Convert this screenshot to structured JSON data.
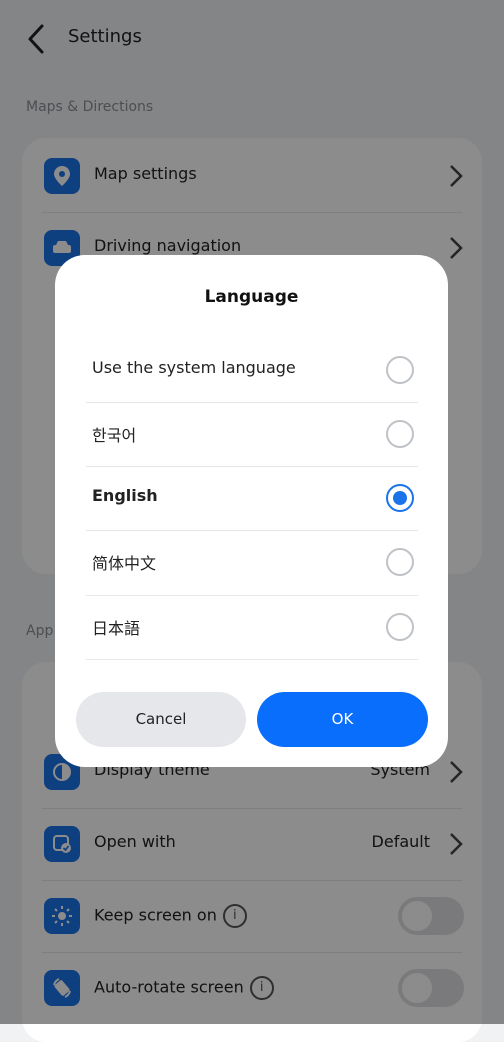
{
  "header": {
    "title": "Settings"
  },
  "sections": {
    "maps": {
      "label": "Maps & Directions"
    },
    "app": {
      "label": "App"
    }
  },
  "maps_items": [
    {
      "label": "Map settings"
    },
    {
      "label": "Driving navigation"
    }
  ],
  "app_items": [
    {
      "label": "Display theme",
      "value": "System"
    },
    {
      "label": "Open with",
      "value": "Default"
    },
    {
      "label": "Keep screen on",
      "toggle": false
    },
    {
      "label": "Auto-rotate screen",
      "toggle": false
    }
  ],
  "dialog": {
    "title": "Language",
    "options": [
      {
        "label": "Use the system language",
        "selected": false
      },
      {
        "label": "한국어",
        "selected": false
      },
      {
        "label": "English",
        "selected": true
      },
      {
        "label": "简体中文",
        "selected": false
      },
      {
        "label": "日本語",
        "selected": false
      }
    ],
    "cancel_label": "Cancel",
    "ok_label": "OK"
  },
  "colors": {
    "accent": "#1a73e8",
    "ok_button": "#0a6efc",
    "cancel_button": "#e5e7eb"
  },
  "icons": [
    "back-arrow-icon",
    "map-pin-icon",
    "car-icon",
    "theme-icon",
    "open-with-icon",
    "brightness-icon",
    "rotate-icon",
    "info-icon",
    "chevron-right-icon"
  ]
}
